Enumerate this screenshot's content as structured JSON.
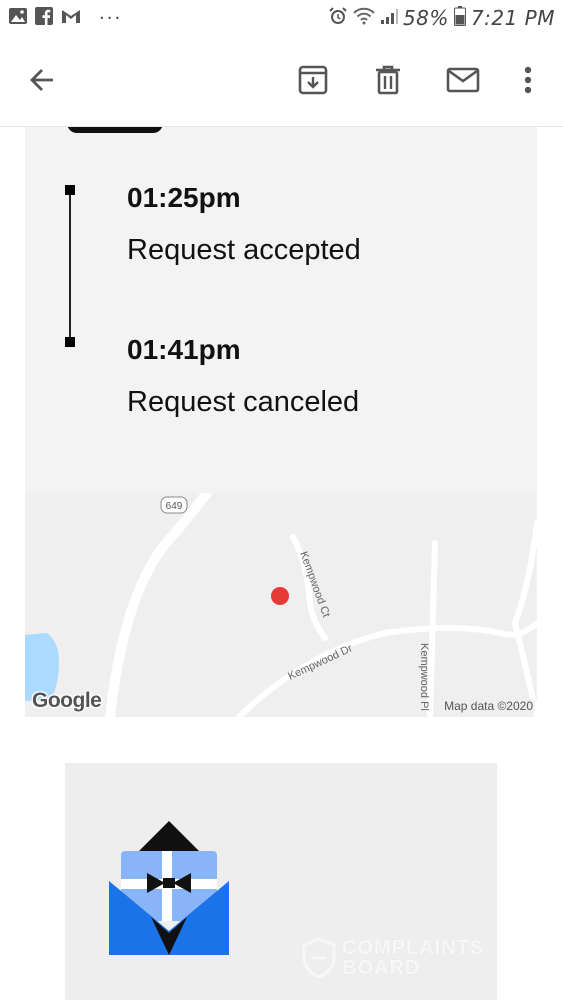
{
  "status_bar": {
    "battery": "58%",
    "time": "7:21 PM",
    "left_icons": [
      "gallery-icon",
      "facebook-icon",
      "gmail-m-icon"
    ],
    "overflow": "···",
    "right_icons": [
      "alarm-icon",
      "wifi-icon",
      "signal-icon",
      "battery-icon"
    ]
  },
  "toolbar": {
    "icons": [
      "back-arrow-icon",
      "archive-icon",
      "delete-icon",
      "mark-unread-icon",
      "more-vert-icon"
    ]
  },
  "timeline": [
    {
      "time": "01:25pm",
      "text": "Request accepted"
    },
    {
      "time": "01:41pm",
      "text": "Request canceled"
    }
  ],
  "map": {
    "route_shield": "649",
    "streets": [
      "Kempwood Ct",
      "Kempwood Dr",
      "Kempwood Pl"
    ],
    "logo": "Google",
    "attribution": "Map data ©2020",
    "marker_color": "#e53935"
  },
  "footer": {
    "watermark_line1": "COMPLAINTS",
    "watermark_line2": "BOARD"
  },
  "colors": {
    "panel_bg": "#f3f3f4",
    "envelope_blue": "#1a73e8",
    "map_water": "#aadaff"
  }
}
